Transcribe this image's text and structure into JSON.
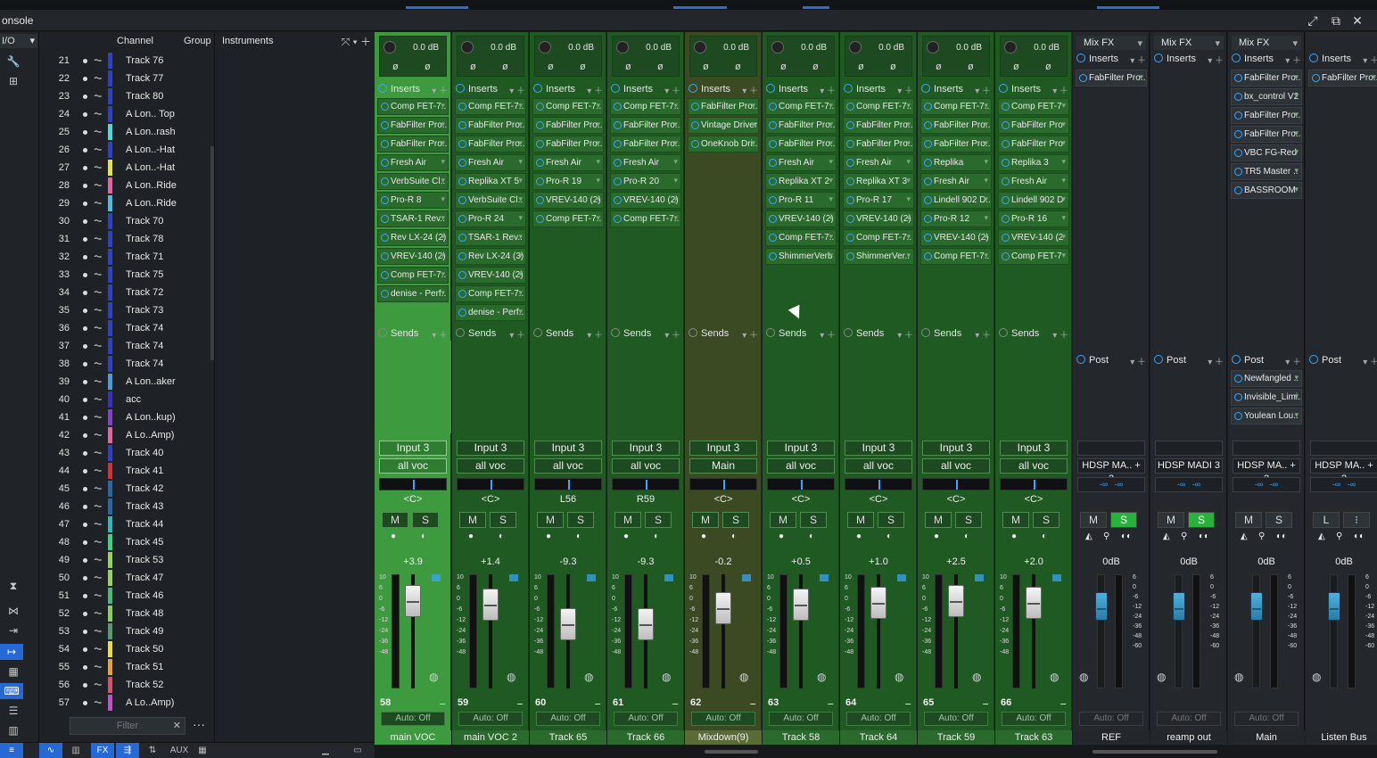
{
  "window": {
    "title": "onsole",
    "controls": [
      "⤢",
      "⧉",
      "✕"
    ]
  },
  "io_label": "I/O",
  "tracklist": {
    "header": {
      "channel": "Channel",
      "group": "Group"
    },
    "rows": [
      {
        "num": "21",
        "color": "#2b3fd9",
        "name": "Track 76"
      },
      {
        "num": "22",
        "color": "#2b3fd9",
        "name": "Track 77"
      },
      {
        "num": "23",
        "color": "#2b3fd9",
        "name": "Track 80"
      },
      {
        "num": "24",
        "color": "#2b3fd9",
        "name": "A Lon.. Top"
      },
      {
        "num": "25",
        "color": "#3fe0e0",
        "name": "A Lon..rash"
      },
      {
        "num": "26",
        "color": "#2b3fd9",
        "name": "A Lon..-Hat"
      },
      {
        "num": "27",
        "color": "#e6e62b",
        "name": "A Lon..-Hat"
      },
      {
        "num": "28",
        "color": "#f05fa0",
        "name": "A Lon..Ride"
      },
      {
        "num": "29",
        "color": "#3fc0f0",
        "name": "A Lon..Ride"
      },
      {
        "num": "30",
        "color": "#2b3fd9",
        "name": "Track 70"
      },
      {
        "num": "31",
        "color": "#2b3fd9",
        "name": "Track 78"
      },
      {
        "num": "32",
        "color": "#2b3fd9",
        "name": "Track 71"
      },
      {
        "num": "33",
        "color": "#2b3fd9",
        "name": "Track 75"
      },
      {
        "num": "34",
        "color": "#2b3fd9",
        "name": "Track 72"
      },
      {
        "num": "35",
        "color": "#2b3fd9",
        "name": "Track 73"
      },
      {
        "num": "36",
        "color": "#2b3fd9",
        "name": "Track 74"
      },
      {
        "num": "37",
        "color": "#2b3fd9",
        "name": "Track 74"
      },
      {
        "num": "38",
        "color": "#2b3fd9",
        "name": "Track 74"
      },
      {
        "num": "39",
        "color": "#3f9fe6",
        "name": "A Lon..aker"
      },
      {
        "num": "40",
        "color": "#3a2bd9",
        "name": "acc"
      },
      {
        "num": "41",
        "color": "#8a3bd9",
        "name": "A Lon..kup)"
      },
      {
        "num": "42",
        "color": "#f05fa0",
        "name": "A Lo..Amp)"
      },
      {
        "num": "43",
        "color": "#2b3fd9",
        "name": "Track 40"
      },
      {
        "num": "44",
        "color": "#e62b2b",
        "name": "Track 41"
      },
      {
        "num": "45",
        "color": "#1e6ab5",
        "name": "Track 42"
      },
      {
        "num": "46",
        "color": "#1e6ab5",
        "name": "Track 43"
      },
      {
        "num": "47",
        "color": "#1ec0c0",
        "name": "Track 44"
      },
      {
        "num": "48",
        "color": "#2be07a",
        "name": "Track 45"
      },
      {
        "num": "49",
        "color": "#8fd94a",
        "name": "Track 53"
      },
      {
        "num": "50",
        "color": "#8fd94a",
        "name": "Track 47"
      },
      {
        "num": "51",
        "color": "#3fc070",
        "name": "Track 46"
      },
      {
        "num": "52",
        "color": "#7fd94a",
        "name": "Track 48"
      },
      {
        "num": "53",
        "color": "#4fa06a",
        "name": "Track 49"
      },
      {
        "num": "54",
        "color": "#f0e02b",
        "name": "Track 50"
      },
      {
        "num": "55",
        "color": "#f0a02b",
        "name": "Track 51"
      },
      {
        "num": "56",
        "color": "#e64a6a",
        "name": "Track 52"
      },
      {
        "num": "57",
        "color": "#c84ad9",
        "name": "A Lo..Amp)"
      }
    ],
    "filter_placeholder": "Filter",
    "filter_clear": "✕",
    "more": "···"
  },
  "instruments": {
    "title": "Instruments"
  },
  "bottom_tabs": {
    "fx": "FX",
    "aux": "AUX"
  },
  "strips": [
    {
      "db": "0.0 dB",
      "inserts_label": "Inserts",
      "plugins": [
        "Comp FET-7..",
        "FabFilter Pro..",
        "FabFilter Pro..",
        "Fresh Air",
        "VerbSuite Cl..",
        "Pro-R 8",
        "TSAR-1 Rev..",
        "Rev LX-24 (2)",
        "VREV-140 (2)",
        "Comp FET-7..",
        "denise - Perf.."
      ],
      "sends_label": "Sends",
      "input": "Input 3",
      "output": "all voc",
      "pan": "<C>",
      "vol": "+3.9",
      "chnum": "58",
      "auto": "Auto: Off",
      "name": "main VOC",
      "type": "sel"
    },
    {
      "db": "0.0 dB",
      "inserts_label": "Inserts",
      "plugins": [
        "Comp FET-7..",
        "FabFilter Pro..",
        "FabFilter Pro..",
        "Fresh Air",
        "Replika XT 5",
        "VerbSuite Cl..",
        "Pro-R 24",
        "TSAR-1 Rev..",
        "Rev LX-24 (3)",
        "VREV-140 (2)",
        "Comp FET-7..",
        "denise - Perf.."
      ],
      "sends_label": "Sends",
      "input": "Input 3",
      "output": "all voc",
      "pan": "<C>",
      "vol": "+1.4",
      "chnum": "59",
      "auto": "Auto: Off",
      "name": "main VOC 2",
      "type": "green"
    },
    {
      "db": "0.0 dB",
      "inserts_label": "Inserts",
      "plugins": [
        "Comp FET-7..",
        "FabFilter Pro..",
        "FabFilter Pro..",
        "Fresh Air",
        "Pro-R 19",
        "VREV-140 (2)",
        "Comp FET-7.."
      ],
      "sends_label": "Sends",
      "input": "Input 3",
      "output": "all voc",
      "pan": "L56",
      "vol": "-9.3",
      "chnum": "60",
      "auto": "Auto: Off",
      "name": "Track 65",
      "type": "green"
    },
    {
      "db": "0.0 dB",
      "inserts_label": "Inserts",
      "plugins": [
        "Comp FET-7..",
        "FabFilter Pro..",
        "FabFilter Pro..",
        "Fresh Air",
        "Pro-R 20",
        "VREV-140 (2)",
        "Comp FET-7.."
      ],
      "sends_label": "Sends",
      "input": "Input 3",
      "output": "all voc",
      "pan": "R59",
      "vol": "-9.3",
      "chnum": "61",
      "auto": "Auto: Off",
      "name": "Track 66",
      "type": "green"
    },
    {
      "db": "0.0 dB",
      "inserts_label": "Inserts",
      "plugins": [
        "FabFilter Pro..",
        "Vintage Driver",
        "OneKnob Dri.."
      ],
      "sends_label": "Sends",
      "input": "Input 3",
      "output": "Main",
      "pan": "<C>",
      "vol": "-0.2",
      "chnum": "62",
      "auto": "Auto: Off",
      "name": "Mixdown(9)",
      "type": "olive"
    },
    {
      "db": "0.0 dB",
      "inserts_label": "Inserts",
      "plugins": [
        "Comp FET-7..",
        "FabFilter Pro..",
        "FabFilter Pro..",
        "Fresh Air",
        "Replika XT 2",
        "Pro-R 11",
        "VREV-140 (2)",
        "Comp FET-7..",
        "ShimmerVerb"
      ],
      "sends_label": "Sends",
      "input": "Input 3",
      "output": "all voc",
      "pan": "<C>",
      "vol": "+0.5",
      "chnum": "63",
      "auto": "Auto: Off",
      "name": "Track 58",
      "type": "green"
    },
    {
      "db": "0.0 dB",
      "inserts_label": "Inserts",
      "plugins": [
        "Comp FET-7..",
        "FabFilter Pro..",
        "FabFilter Pro..",
        "Fresh Air",
        "Replika XT 3",
        "Pro-R 17",
        "VREV-140 (2)",
        "Comp FET-7..",
        "ShimmerVer.."
      ],
      "sends_label": "Sends",
      "input": "Input 3",
      "output": "all voc",
      "pan": "<C>",
      "vol": "+1.0",
      "chnum": "64",
      "auto": "Auto: Off",
      "name": "Track 64",
      "type": "green"
    },
    {
      "db": "0.0 dB",
      "inserts_label": "Inserts",
      "plugins": [
        "Comp FET-7..",
        "FabFilter Pro..",
        "FabFilter Pro..",
        "Replika",
        "Fresh Air",
        "Lindell 902 D..",
        "Pro-R 12",
        "VREV-140 (2)",
        "Comp FET-7.."
      ],
      "sends_label": "Sends",
      "input": "Input 3",
      "output": "all voc",
      "pan": "<C>",
      "vol": "+2.5",
      "chnum": "65",
      "auto": "Auto: Off",
      "name": "Track 59",
      "type": "green"
    },
    {
      "db": "0.0 dB",
      "inserts_label": "Inserts",
      "plugins": [
        "Comp FET-7",
        "FabFilter Pro",
        "FabFilter Pro",
        "Replika 3",
        "Fresh Air",
        "Lindell 902 D",
        "Pro-R 16",
        "VREV-140 (2",
        "Comp FET-7"
      ],
      "sends_label": "Sends",
      "input": "Input 3",
      "output": "all voc",
      "pan": "<C>",
      "vol": "+2.0",
      "chnum": "66",
      "auto": "Auto: Off",
      "name": "Track 63",
      "type": "green"
    }
  ],
  "buses": [
    {
      "mixfx": "Mix FX",
      "inserts_label": "Inserts",
      "plugins": [
        "FabFilter Pro.."
      ],
      "post_label": "Post",
      "post_plugins": [],
      "output": "HDSP MA.. + 2",
      "vol": "0dB",
      "auto": "Auto: Off",
      "name": "REF",
      "m": "M",
      "s": "S",
      "s_on": true
    },
    {
      "mixfx": "Mix FX",
      "inserts_label": "Inserts",
      "plugins": [],
      "post_label": "Post",
      "post_plugins": [],
      "output": "HDSP MADI 3",
      "vol": "0dB",
      "auto": "Auto: Off",
      "name": "reamp out",
      "m": "M",
      "s": "S",
      "s_on": true
    },
    {
      "mixfx": "Mix FX",
      "inserts_label": "Inserts",
      "plugins": [
        "FabFilter Pro..",
        "bx_control V2",
        "FabFilter Pro..",
        "FabFilter Pro..",
        "VBC FG-Red",
        "TR5 Master ..",
        "BASSROOM"
      ],
      "post_label": "Post",
      "post_plugins": [
        "Newfangled ..",
        "Invisible_Limi..",
        "Youlean Lou.."
      ],
      "output": "HDSP MA.. + 2",
      "vol": "0dB",
      "auto": "Auto: Off",
      "name": "Main",
      "m": "M",
      "s": "S",
      "s_on": false
    },
    {
      "mixfx": "",
      "inserts_label": "Inserts",
      "plugins": [
        "FabFilter Pro.."
      ],
      "post_label": "Post",
      "post_plugins": [],
      "output": "HDSP MA.. + 2",
      "vol": "0dB",
      "auto": "",
      "name": "Listen Bus",
      "m": "L",
      "s": "⁝",
      "s_on": false
    }
  ],
  "labels": {
    "mute": "M",
    "solo": "S",
    "phase": "ø",
    "scale": [
      "10",
      "6",
      "0",
      "-6",
      "-12",
      "-24",
      "-36",
      "-48"
    ],
    "scale2": [
      "6",
      "0",
      "-6",
      "-12",
      "-24",
      "-36",
      "-48",
      "-60"
    ]
  }
}
